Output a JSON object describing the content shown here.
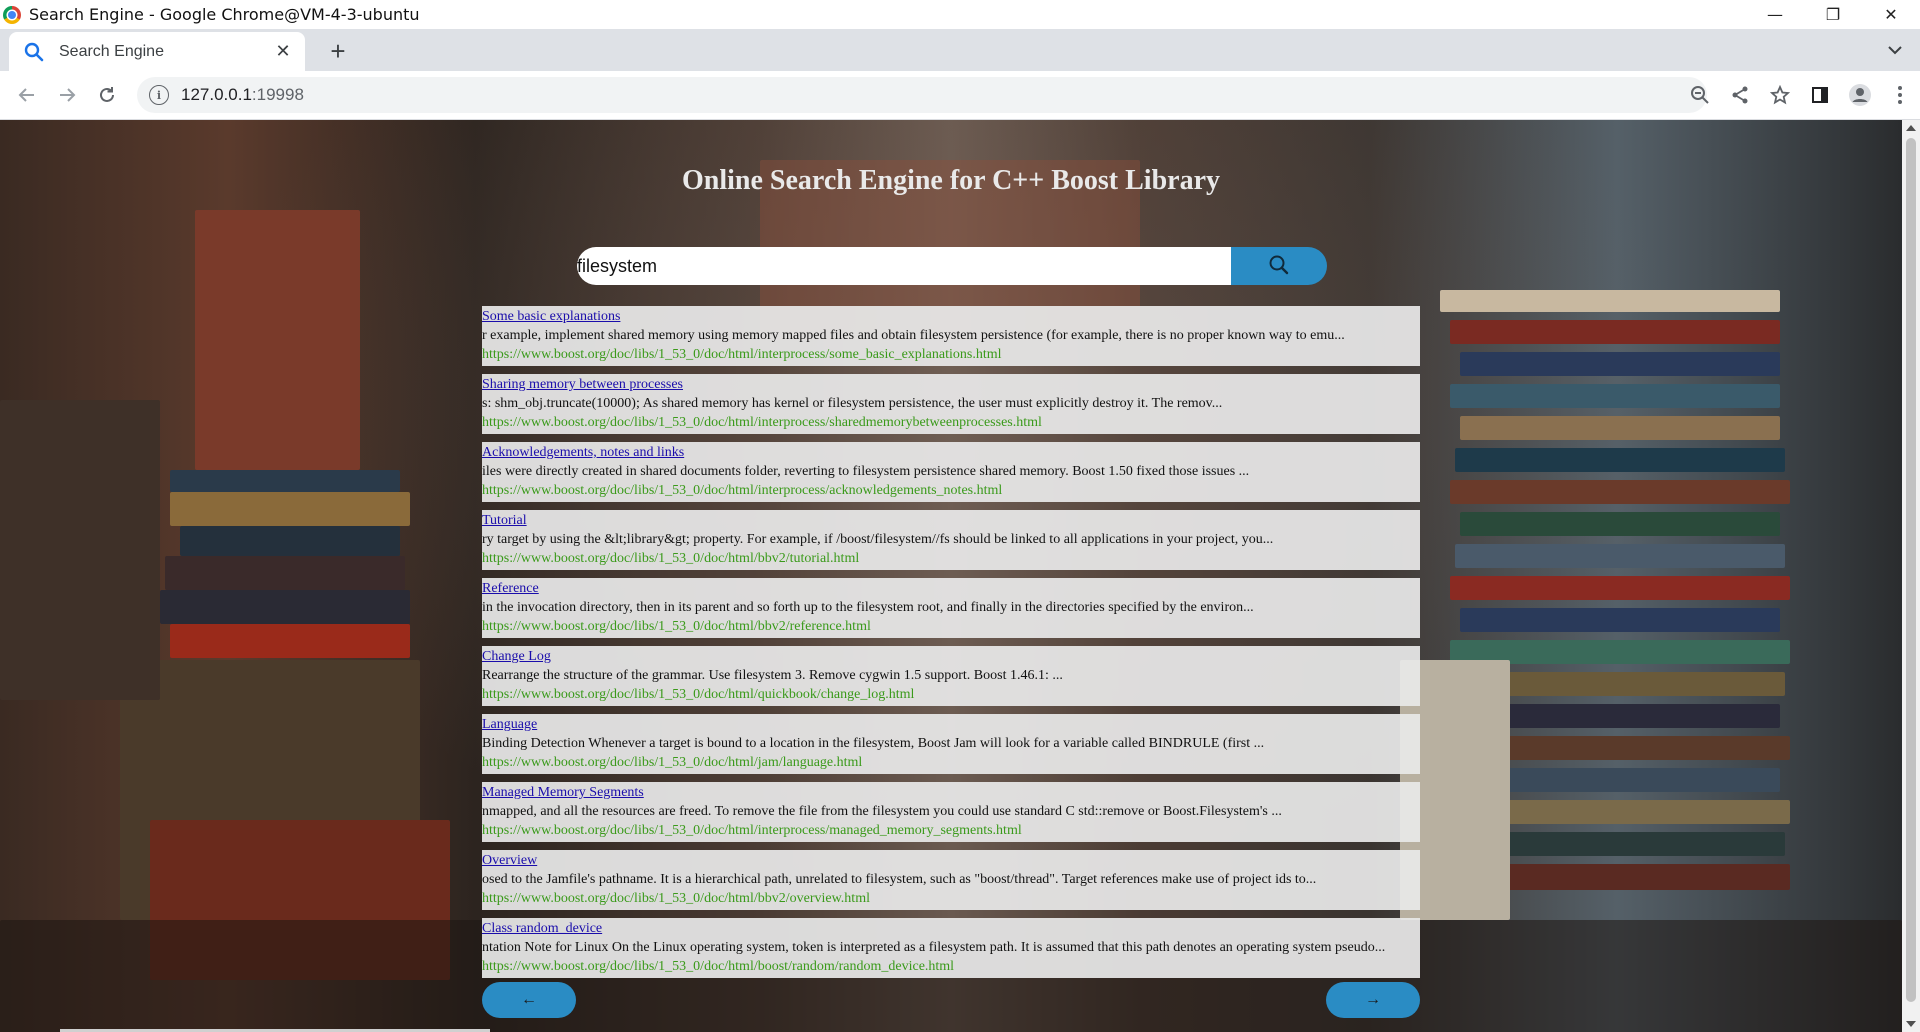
{
  "window": {
    "title": "Search Engine - Google Chrome@VM-4-3-ubuntu",
    "controls": {
      "minimize": "—",
      "restore": "❐",
      "close": "✕"
    }
  },
  "tab": {
    "title": "Search Engine",
    "close": "✕",
    "new_tab": "+"
  },
  "toolbar": {
    "url_host": "127.0.0.1",
    "url_port": ":19998",
    "icons": [
      "back-icon",
      "forward-icon",
      "reload-icon",
      "info-icon",
      "zoom-icon",
      "share-icon",
      "bookmark-star-icon",
      "side-panel-icon",
      "profile-icon",
      "menu-icon"
    ]
  },
  "page": {
    "title": "Online Search Engine for C++ Boost Library",
    "search": {
      "value": "filesystem"
    },
    "results": [
      {
        "title": "Some basic explanations",
        "desc": "r example, implement shared memory using memory mapped files and obtain filesystem persistence (for example, there is no proper known way to emu...",
        "url": "https://www.boost.org/doc/libs/1_53_0/doc/html/interprocess/some_basic_explanations.html"
      },
      {
        "title": "Sharing memory between processes",
        "desc": "s: shm_obj.truncate(10000); As shared memory has kernel or filesystem persistence, the user must explicitly destroy it. The remov...",
        "url": "https://www.boost.org/doc/libs/1_53_0/doc/html/interprocess/sharedmemorybetweenprocesses.html"
      },
      {
        "title": "Acknowledgements, notes and links",
        "desc": "iles were directly created in shared documents folder, reverting to filesystem persistence shared memory. Boost 1.50 fixed those issues ...",
        "url": "https://www.boost.org/doc/libs/1_53_0/doc/html/interprocess/acknowledgements_notes.html"
      },
      {
        "title": "Tutorial",
        "desc": "ry target by using the &lt;library&gt; property. For example, if /boost/filesystem//fs should be linked to all applications in your project, you...",
        "url": "https://www.boost.org/doc/libs/1_53_0/doc/html/bbv2/tutorial.html"
      },
      {
        "title": "Reference",
        "desc": "in the invocation directory, then in its parent and so forth up to the filesystem root, and finally in the directories specified by the environ...",
        "url": "https://www.boost.org/doc/libs/1_53_0/doc/html/bbv2/reference.html"
      },
      {
        "title": "Change Log",
        "desc": "Rearrange the structure of the grammar. Use filesystem 3. Remove cygwin 1.5 support. Boost 1.46.1: ...",
        "url": "https://www.boost.org/doc/libs/1_53_0/doc/html/quickbook/change_log.html"
      },
      {
        "title": "Language",
        "desc": "Binding Detection Whenever a target is bound to a location in the filesystem, Boost Jam will look for a variable called BINDRULE (first ...",
        "url": "https://www.boost.org/doc/libs/1_53_0/doc/html/jam/language.html"
      },
      {
        "title": "Managed Memory Segments",
        "desc": "nmapped, and all the resources are freed. To remove the file from the filesystem you could use standard C std::remove or Boost.Filesystem's ...",
        "url": "https://www.boost.org/doc/libs/1_53_0/doc/html/interprocess/managed_memory_segments.html"
      },
      {
        "title": "Overview",
        "desc": "osed to the Jamfile's pathname. It is a hierarchical path, unrelated to filesystem, such as \"boost/thread\". Target references make use of project ids to...",
        "url": "https://www.boost.org/doc/libs/1_53_0/doc/html/bbv2/overview.html"
      },
      {
        "title": "Class random_device",
        "desc": "ntation Note for Linux On the Linux operating system, token is interpreted as a filesystem path. It is assumed that this path denotes an operating system pseudo...",
        "url": "https://www.boost.org/doc/libs/1_53_0/doc/html/boost/random/random_device.html"
      }
    ],
    "pager": {
      "prev": "←",
      "next": "→"
    }
  },
  "colors": {
    "accent": "#2a8cc4",
    "link": "#1a0dab",
    "url": "#3a9a1a"
  }
}
